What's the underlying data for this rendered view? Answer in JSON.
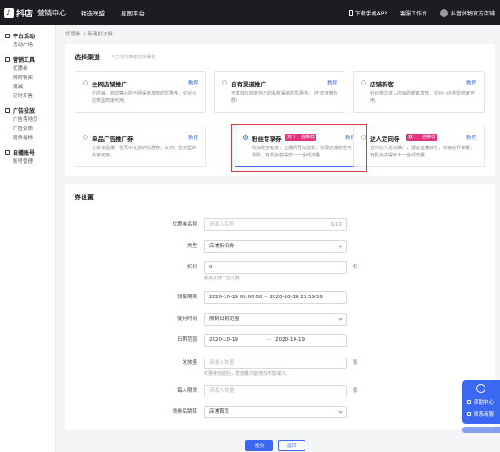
{
  "topbar": {
    "logo_mark": "♪",
    "brand": "抖店",
    "brand_sub": "营销中心",
    "nav": [
      "精选联盟",
      "星图平台"
    ],
    "download": "下载手机APP",
    "workspace": "客服工作台",
    "shop": "抖音好物官方店铺"
  },
  "sidebar": [
    {
      "title": "平台活动",
      "items": [
        "活动广场"
      ]
    },
    {
      "title": "营销工具",
      "items": [
        "优惠券",
        "限时特卖",
        "满减",
        "定时开售"
      ]
    },
    {
      "title": "广告投放",
      "items": [
        "广告落地页",
        "广告资质",
        "服务指标"
      ]
    },
    {
      "title": "自播账号",
      "items": [
        "账号管理"
      ]
    }
  ],
  "breadcrumb": [
    "优惠券",
    "新建批次券"
  ],
  "channel": {
    "title": "选择渠道",
    "tip": "• 已为您推荐合适渠道",
    "options": [
      {
        "name": "全网店铺推广",
        "guide": "教程",
        "desc": "在店铺、商详等小店全网渠道发放的优惠券，仅对小店类型商家可用。",
        "tag": ""
      },
      {
        "name": "自有渠道推广",
        "guide": "教程",
        "desc": "可发放在商家自己的私有渠道的优惠券。（不支持微信群）",
        "tag": ""
      },
      {
        "name": "店铺新客",
        "guide": "教程",
        "desc": "针对首次进入店铺的新客发放，仅对小店类型商家可用。",
        "tag": ""
      },
      {
        "name": "单品广告推广券",
        "guide": "教程",
        "desc": "在投单品推广告页中发放的优惠券，仅对广告类型的商家可用。",
        "tag": ""
      },
      {
        "name": "粉丝专享券",
        "guide": "教程",
        "desc": "增加粉丝粘度，直播间互动送粉，仅限店铺粉丝可领取，有机会获得双十一全线流量",
        "tag": "双十一强推荐"
      },
      {
        "name": "达人定向券",
        "guide": "教程",
        "desc": "合作达人定向推广，促进直播转化，快速提升销量，有机会获得双十一全线流量",
        "tag": "双十一强推荐"
      }
    ]
  },
  "coupon": {
    "title": "券设置",
    "fields": [
      {
        "label": "优惠券名称",
        "value": "请输入名称",
        "placeholder": true,
        "count": "0/10"
      },
      {
        "label": "类型",
        "value": "店铺折扣券",
        "select": true
      },
      {
        "label": "折扣",
        "value": "0",
        "suffix": "折",
        "help": "最多支持一位小数"
      },
      {
        "label": "领取期限",
        "value": "2020-10-19 00:00:00 ~ 2020-10-19 23:59:59",
        "calendar": true
      },
      {
        "label": "使用时间",
        "value": "限制日期范围",
        "select": true
      },
      {
        "label": "日期范围",
        "value_from": "2020-10-19",
        "value_to": "2020-10-19",
        "sep": "—"
      },
      {
        "label": "发放量",
        "value": "请输入数量",
        "placeholder": true,
        "suffix": "张",
        "help": "优惠券创建后，发放量只能增加不能减少。"
      },
      {
        "label": "每人限领",
        "value": "请输入数量",
        "placeholder": true,
        "suffix": "张"
      },
      {
        "label": "领券后跳转",
        "value": "店铺首页",
        "select": true
      }
    ]
  },
  "actions": {
    "submit": "提交",
    "back": "返回"
  },
  "helpdock": {
    "help": "帮助中心",
    "contact": "联系商服"
  }
}
